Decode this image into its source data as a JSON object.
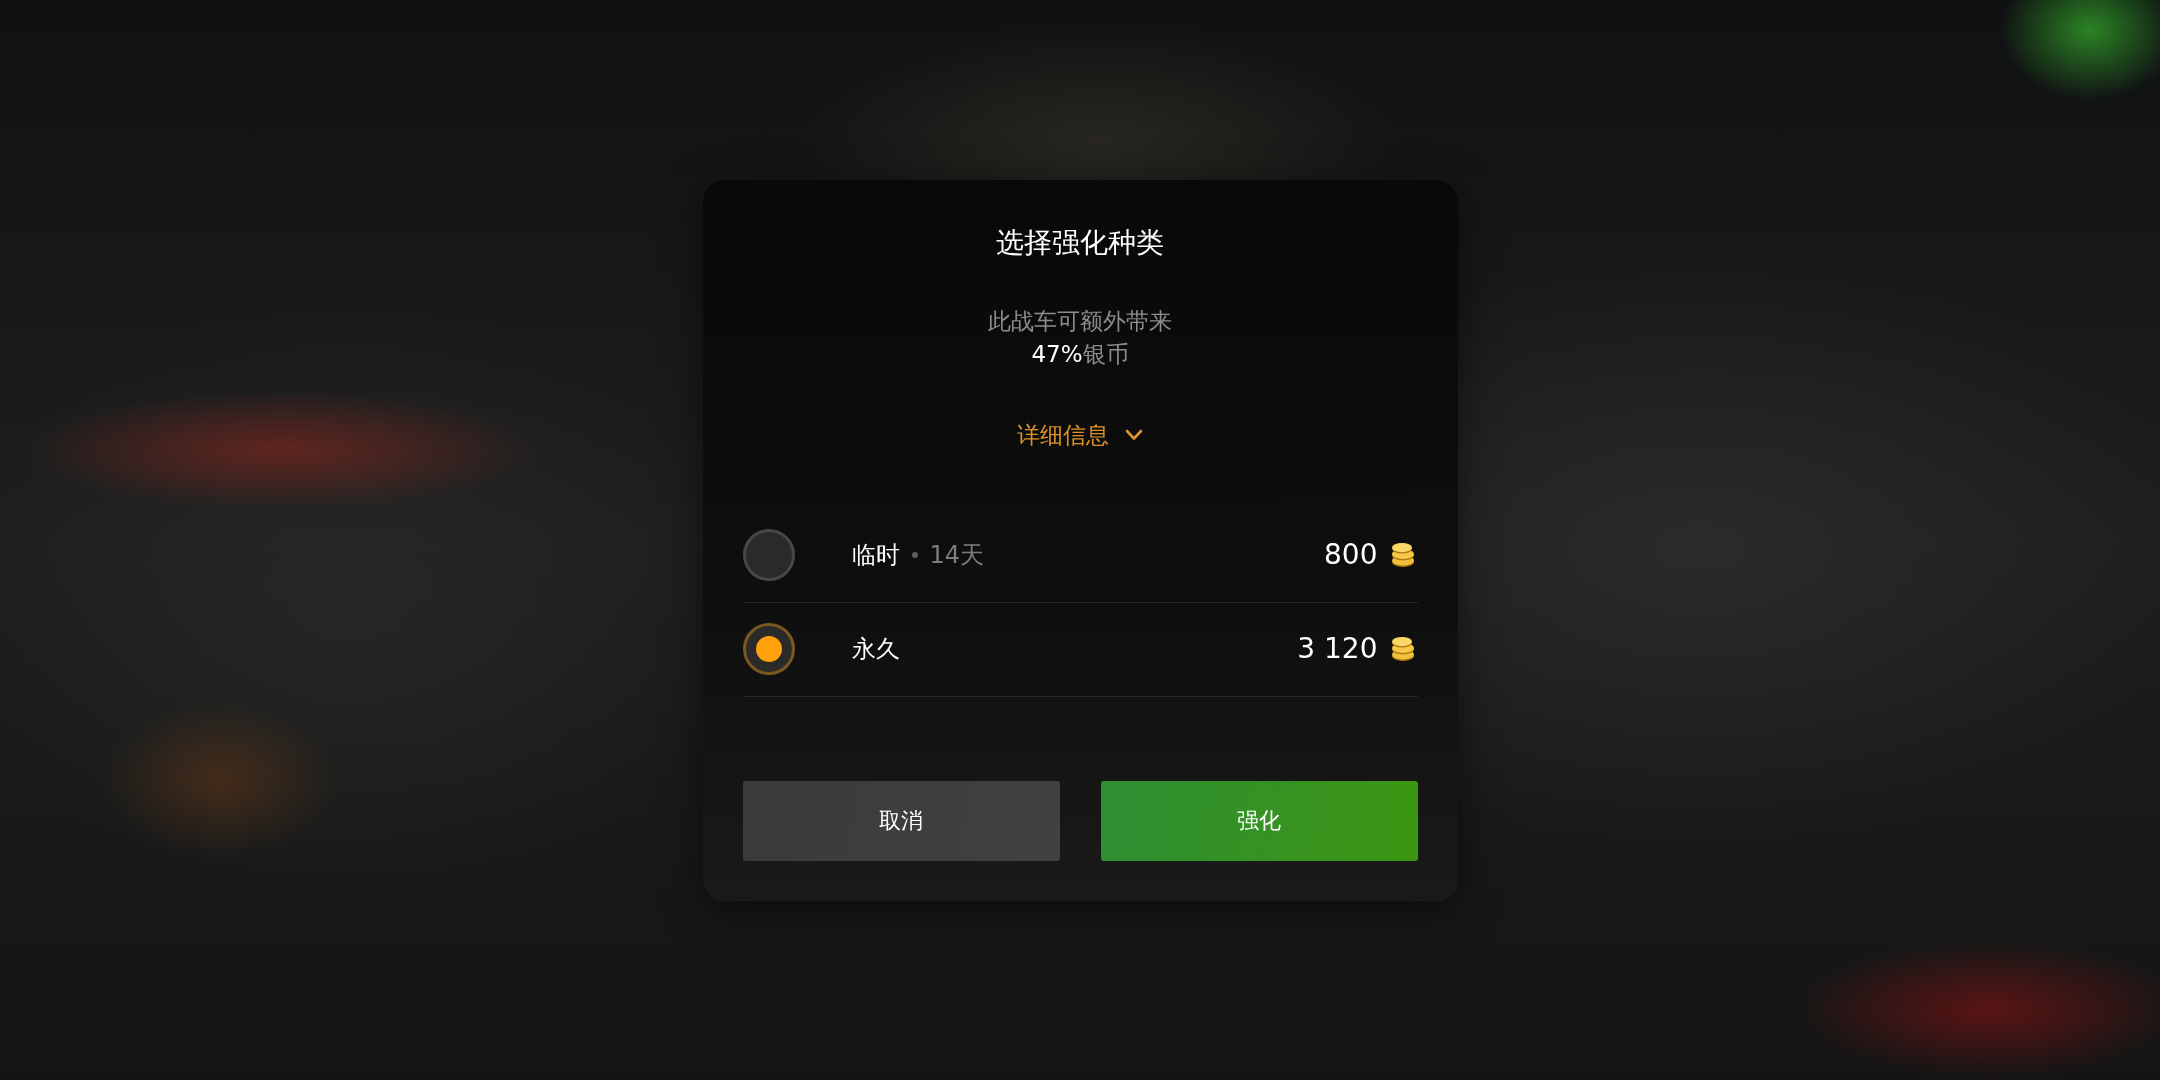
{
  "dialog": {
    "title": "选择强化种类",
    "description": {
      "text": "此战车可额外带来",
      "highlight": "47%",
      "unit": "银币"
    },
    "details_toggle": {
      "label": "详细信息",
      "expanded": false
    },
    "options": [
      {
        "label": "临时",
        "duration": "14天",
        "price": "800",
        "selected": false
      },
      {
        "label": "永久",
        "price": "3 120",
        "selected": true
      }
    ],
    "buttons": [
      {
        "label": "取消",
        "kind": "secondary"
      },
      {
        "label": "强化",
        "kind": "primary"
      }
    ]
  }
}
